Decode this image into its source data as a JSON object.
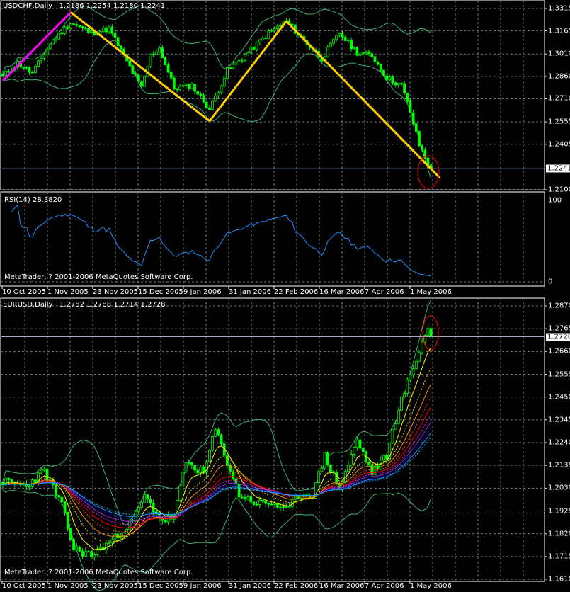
{
  "colors": {
    "background": "#000000",
    "grid": "#6b7b8c",
    "candle": "#00ff00",
    "bands": "#3cb371",
    "rsi": "#1e90ff",
    "trend_up": "#ff00ff",
    "trend_down": "#ffcc00",
    "marker": "#ff0000"
  },
  "copyright": "MetaTrader, ? 2001-2006 MetaQuotes Software Corp.",
  "dates": [
    "10 Oct 2005",
    "1 Nov 2005",
    "23 Nov 2005",
    "15 Dec 2005",
    "9 Jan 2006",
    "31 Jan 2006",
    "22 Feb 2006",
    "16 Mar 2006",
    "7 Apr 2006",
    "1 May 2006"
  ],
  "chart_data": [
    {
      "type": "candlestick",
      "title": "USDCHF,Daily",
      "ohlc": "1.2186 1.2254 1.2180 1.2241",
      "current_price": "1.2241",
      "y_ticks": [
        "1.3315",
        "1.3165",
        "1.3010",
        "1.2860",
        "1.2710",
        "1.2555",
        "1.2405",
        "1.2100"
      ],
      "ylim": [
        1.21,
        1.3315
      ],
      "bars": 146,
      "close_keypoints": [
        [
          0,
          1.286
        ],
        [
          5,
          1.295
        ],
        [
          10,
          1.288
        ],
        [
          16,
          1.308
        ],
        [
          23,
          1.322
        ],
        [
          30,
          1.315
        ],
        [
          36,
          1.318
        ],
        [
          42,
          1.296
        ],
        [
          47,
          1.278
        ],
        [
          50,
          1.3
        ],
        [
          53,
          1.305
        ],
        [
          58,
          1.278
        ],
        [
          64,
          1.28
        ],
        [
          70,
          1.264
        ],
        [
          76,
          1.29
        ],
        [
          82,
          1.3
        ],
        [
          90,
          1.315
        ],
        [
          96,
          1.323
        ],
        [
          102,
          1.31
        ],
        [
          108,
          1.298
        ],
        [
          114,
          1.315
        ],
        [
          120,
          1.302
        ],
        [
          125,
          1.3
        ],
        [
          130,
          1.285
        ],
        [
          135,
          1.28
        ],
        [
          138,
          1.262
        ],
        [
          141,
          1.24
        ],
        [
          144,
          1.228
        ],
        [
          145,
          1.2241
        ]
      ],
      "indicators": [
        "Bollinger Bands(20,2)"
      ],
      "trendlines": [
        {
          "color": "trend_up",
          "from": [
            0,
            1.283
          ],
          "to": [
            23,
            1.329
          ]
        },
        {
          "color": "trend_down",
          "from": [
            23,
            1.329
          ],
          "to": [
            70,
            1.256
          ]
        },
        {
          "color": "trend_down",
          "from": [
            70,
            1.256
          ],
          "to": [
            96,
            1.323
          ]
        },
        {
          "color": "trend_down",
          "from": [
            96,
            1.323
          ],
          "to": [
            148,
            1.218
          ]
        }
      ]
    },
    {
      "type": "line",
      "title": "RSI(14) 28.3820",
      "y_ticks": [
        "100",
        "0"
      ],
      "ylim": [
        0,
        100
      ],
      "source": "USDCHF closes"
    },
    {
      "type": "candlestick",
      "title": "EURUSD,Daily",
      "ohlc": "1.2782 1.2788 1.2714 1.2728",
      "current_price": "1.2728",
      "y_ticks": [
        "1.2870",
        "1.2765",
        "1.2660",
        "1.2555",
        "1.2450",
        "1.2345",
        "1.2240",
        "1.2135",
        "1.2030",
        "1.1925",
        "1.1820",
        "1.1715",
        "1.1610"
      ],
      "ylim": [
        1.161,
        1.287
      ],
      "bars": 146,
      "close_keypoints": [
        [
          0,
          1.206
        ],
        [
          8,
          1.204
        ],
        [
          14,
          1.211
        ],
        [
          20,
          1.195
        ],
        [
          24,
          1.175
        ],
        [
          30,
          1.172
        ],
        [
          38,
          1.18
        ],
        [
          44,
          1.188
        ],
        [
          48,
          1.199
        ],
        [
          54,
          1.188
        ],
        [
          58,
          1.19
        ],
        [
          62,
          1.215
        ],
        [
          68,
          1.21
        ],
        [
          72,
          1.23
        ],
        [
          76,
          1.215
        ],
        [
          80,
          1.2
        ],
        [
          86,
          1.196
        ],
        [
          92,
          1.196
        ],
        [
          96,
          1.192
        ],
        [
          100,
          1.2
        ],
        [
          105,
          1.2
        ],
        [
          109,
          1.218
        ],
        [
          114,
          1.203
        ],
        [
          120,
          1.225
        ],
        [
          125,
          1.21
        ],
        [
          130,
          1.218
        ],
        [
          134,
          1.24
        ],
        [
          138,
          1.255
        ],
        [
          142,
          1.27
        ],
        [
          144,
          1.2765
        ],
        [
          145,
          1.2728
        ]
      ],
      "indicators": [
        "Bollinger Bands(20,2)",
        "Moving average ribbon"
      ]
    }
  ]
}
